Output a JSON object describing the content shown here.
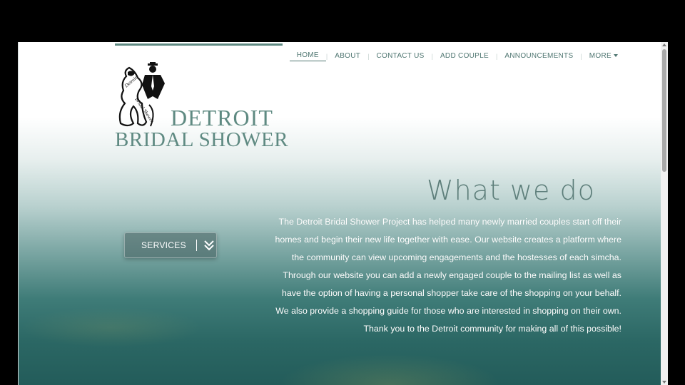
{
  "brand": {
    "line1": "DETROIT",
    "line2": "BRIDAL SHOWER",
    "logo_icon": "bride-groom-silhouette-icon",
    "color": "#5f8a82"
  },
  "nav": {
    "items": [
      {
        "label": "HOME",
        "active": true
      },
      {
        "label": "ABOUT"
      },
      {
        "label": "CONTACT US"
      },
      {
        "label": "ADD COUPLE"
      },
      {
        "label": "ANNOUNCEMENTS"
      },
      {
        "label": "MORE",
        "icon": "caret-down-icon"
      }
    ]
  },
  "hero": {
    "heading": "What we do",
    "lines": [
      "The Detroit Bridal Shower Project has helped many newly married couples start off their",
      "homes and begin their new life together with ease. Our website creates a platform where",
      "the community can view upcoming engagements and the hostesses of each simcha.",
      "Through our website you can add a newly engaged couple to the mailing list as well as",
      "have the option of having a personal shopper take care of the shopping on your behalf.",
      "We also provide a shopping guide for those who are interested in shopping on their own.",
      "Thank you to the Detroit community for making all of this possible!"
    ]
  },
  "services_button": {
    "label": "SERVICES",
    "icon": "double-chevron-down-icon"
  }
}
